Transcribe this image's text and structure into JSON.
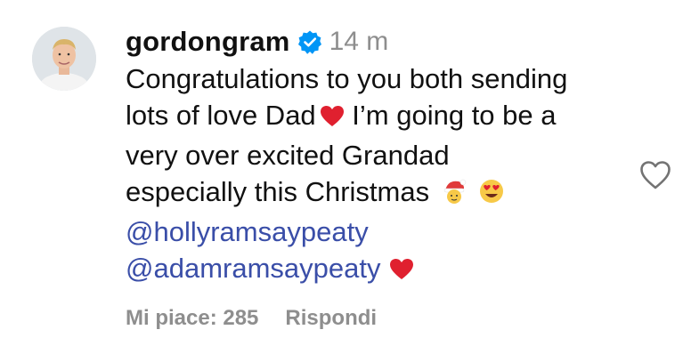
{
  "comment": {
    "username": "gordongram",
    "verified": true,
    "time": "14 m",
    "lines": [
      "Congratulations to you both sending",
      "lots of love Dad",
      "I’m going to be a",
      "very over excited Grandad",
      "especially this Christmas"
    ],
    "mentions": [
      "@hollyramsaypeaty",
      "@adamramsaypeaty"
    ],
    "likes_label": "Mi piace: 285",
    "reply_label": "Rispondi"
  },
  "icons": {
    "verified": "verified-badge-icon",
    "heart_emoji": "red-heart-emoji",
    "santa_emoji": "baby-santa-emoji",
    "heart_eyes_emoji": "heart-eyes-emoji",
    "like": "heart-outline-icon"
  },
  "colors": {
    "mention": "#3a4ea8",
    "verified": "#0095f6",
    "muted": "#8e8e8e",
    "heart": "#e0202f"
  }
}
